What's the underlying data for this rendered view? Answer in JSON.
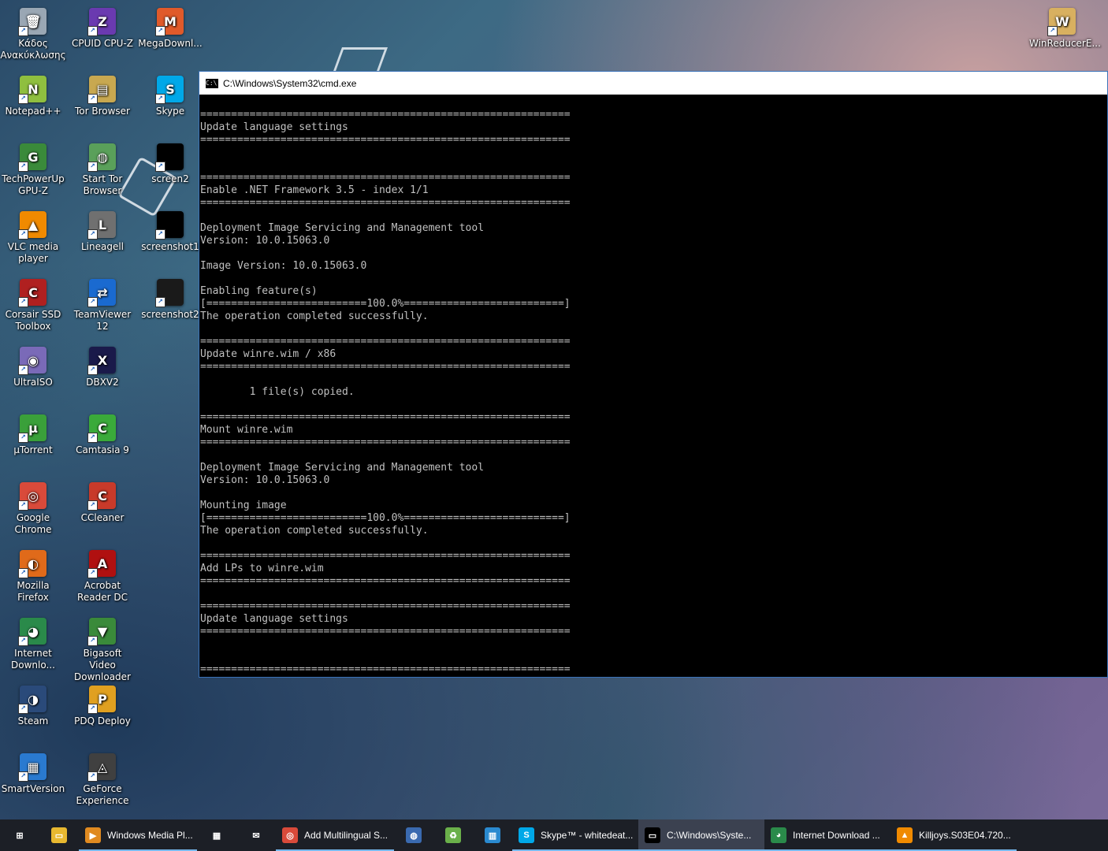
{
  "desktop": {
    "icons_col1": [
      {
        "label": "Κάδος Ανακύκλωσης",
        "icon": "recycle-bin-icon",
        "color": "#9aa7b4",
        "glyph": "🗑"
      },
      {
        "label": "Notepad++",
        "icon": "notepad-plus-plus-icon",
        "color": "#8fbf3f",
        "glyph": "N"
      },
      {
        "label": "TechPowerUp GPU-Z",
        "icon": "gpu-z-icon",
        "color": "#3a8a3a",
        "glyph": "G"
      },
      {
        "label": "VLC media player",
        "icon": "vlc-icon",
        "color": "#f08a00",
        "glyph": "▲"
      },
      {
        "label": "Corsair SSD Toolbox",
        "icon": "corsair-icon",
        "color": "#b02020",
        "glyph": "C"
      },
      {
        "label": "UltraISO",
        "icon": "ultraiso-icon",
        "color": "#7a6ab8",
        "glyph": "◉"
      },
      {
        "label": "µTorrent",
        "icon": "utorrent-icon",
        "color": "#3aa03a",
        "glyph": "µ"
      },
      {
        "label": "Google Chrome",
        "icon": "chrome-icon",
        "color": "#d94a3a",
        "glyph": "◎"
      },
      {
        "label": "Mozilla Firefox",
        "icon": "firefox-icon",
        "color": "#e06a1a",
        "glyph": "◐"
      },
      {
        "label": "Internet Downlo...",
        "icon": "idm-icon",
        "color": "#2a8a4a",
        "glyph": "◕"
      },
      {
        "label": "Steam",
        "icon": "steam-icon",
        "color": "#2a4a7a",
        "glyph": "◑"
      },
      {
        "label": "SmartVersion",
        "icon": "smartversion-icon",
        "color": "#2a7ad0",
        "glyph": "▦"
      }
    ],
    "icons_col2": [
      {
        "label": "CPUID CPU-Z",
        "icon": "cpu-z-icon",
        "color": "#6a3ab0",
        "glyph": "Z"
      },
      {
        "label": "Tor Browser",
        "icon": "tor-browser-icon",
        "color": "#c8a850",
        "glyph": "▤"
      },
      {
        "label": "Start Tor Browser",
        "icon": "start-tor-icon",
        "color": "#5aa05a",
        "glyph": "◍"
      },
      {
        "label": "Lineagell",
        "icon": "lineage-icon",
        "color": "#707070",
        "glyph": "L"
      },
      {
        "label": "TeamViewer 12",
        "icon": "teamviewer-icon",
        "color": "#1a6ad0",
        "glyph": "⇄"
      },
      {
        "label": "DBXV2",
        "icon": "dbxv2-icon",
        "color": "#1a1a4a",
        "glyph": "X"
      },
      {
        "label": "Camtasia 9",
        "icon": "camtasia-icon",
        "color": "#3aaa3a",
        "glyph": "C"
      },
      {
        "label": "CCleaner",
        "icon": "ccleaner-icon",
        "color": "#c83a2a",
        "glyph": "C"
      },
      {
        "label": "Acrobat Reader DC",
        "icon": "acrobat-icon",
        "color": "#b01010",
        "glyph": "A"
      },
      {
        "label": "Bigasoft Video Downloader ...",
        "icon": "bigasoft-icon",
        "color": "#3a8a3a",
        "glyph": "▼"
      },
      {
        "label": "PDQ Deploy",
        "icon": "pdq-deploy-icon",
        "color": "#e0a020",
        "glyph": "P"
      },
      {
        "label": "GeForce Experience",
        "icon": "geforce-icon",
        "color": "#404040",
        "glyph": "◬"
      }
    ],
    "icons_col3": [
      {
        "label": "MegaDownl...",
        "icon": "megadownloader-icon",
        "color": "#e05a2a",
        "glyph": "M"
      },
      {
        "label": "Skype",
        "icon": "skype-icon",
        "color": "#00a8e8",
        "glyph": "S"
      },
      {
        "label": "screen2",
        "icon": "screen2-icon",
        "color": "#000000",
        "glyph": ""
      },
      {
        "label": "screenshot1",
        "icon": "screenshot1-icon",
        "color": "#000000",
        "glyph": ""
      },
      {
        "label": "screenshot2",
        "icon": "screenshot2-icon",
        "color": "#1a1a1a",
        "glyph": ""
      }
    ],
    "top_right_icon": {
      "label": "WinReducerE...",
      "icon": "winreducer-icon",
      "color": "#d8b060",
      "glyph": "W"
    }
  },
  "cmd_window": {
    "title": "C:\\Windows\\System32\\cmd.exe",
    "lines": [
      "============================================================",
      "Update language settings",
      "============================================================",
      "",
      "",
      "============================================================",
      "Enable .NET Framework 3.5 - index 1/1",
      "============================================================",
      "",
      "Deployment Image Servicing and Management tool",
      "Version: 10.0.15063.0",
      "",
      "Image Version: 10.0.15063.0",
      "",
      "Enabling feature(s)",
      "[==========================100.0%==========================]",
      "The operation completed successfully.",
      "",
      "============================================================",
      "Update winre.wim / x86",
      "============================================================",
      "",
      "        1 file(s) copied.",
      "",
      "============================================================",
      "Mount winre.wim",
      "============================================================",
      "",
      "Deployment Image Servicing and Management tool",
      "Version: 10.0.15063.0",
      "",
      "Mounting image",
      "[==========================100.0%==========================]",
      "The operation completed successfully.",
      "",
      "============================================================",
      "Add LPs to winre.wim",
      "============================================================",
      "",
      "============================================================",
      "Update language settings",
      "============================================================",
      "",
      "",
      "============================================================"
    ]
  },
  "taskbar": {
    "items": [
      {
        "label": "",
        "icon": "windows-start-icon",
        "color": "#1c1f26",
        "glyph": "⊞",
        "width": 50,
        "state": "none"
      },
      {
        "label": "",
        "icon": "file-explorer-icon",
        "color": "#e8b830",
        "glyph": "▭",
        "width": 50,
        "state": "none"
      },
      {
        "label": "Windows Media Pl...",
        "icon": "windows-media-player-icon",
        "color": "#e08a20",
        "glyph": "▶",
        "width": 150,
        "state": "running"
      },
      {
        "label": "",
        "icon": "store-icon",
        "color": "#1c1f26",
        "glyph": "▦",
        "width": 50,
        "state": "none"
      },
      {
        "label": "",
        "icon": "mail-icon",
        "color": "#1c1f26",
        "glyph": "✉",
        "width": 50,
        "state": "none"
      },
      {
        "label": "Add Multilingual S...",
        "icon": "chrome-taskbar-icon",
        "color": "#d94a3a",
        "glyph": "◎",
        "width": 150,
        "state": "running"
      },
      {
        "label": "",
        "icon": "search-globe-icon",
        "color": "#3a6ab0",
        "glyph": "◍",
        "width": 50,
        "state": "none"
      },
      {
        "label": "",
        "icon": "recycle-green-icon",
        "color": "#6ab04a",
        "glyph": "♻",
        "width": 50,
        "state": "none"
      },
      {
        "label": "",
        "icon": "building-icon",
        "color": "#2a8ad0",
        "glyph": "▥",
        "width": 50,
        "state": "none"
      },
      {
        "label": "Skype™ - whitedeat...",
        "icon": "skype-taskbar-icon",
        "color": "#00a8e8",
        "glyph": "S",
        "width": 160,
        "state": "running"
      },
      {
        "label": "C:\\Windows\\Syste...",
        "icon": "cmd-taskbar-icon",
        "color": "#000000",
        "glyph": "▭",
        "width": 160,
        "state": "active"
      },
      {
        "label": "Internet Download ...",
        "icon": "idm-taskbar-icon",
        "color": "#2a8a4a",
        "glyph": "◕",
        "width": 160,
        "state": "running"
      },
      {
        "label": "Killjoys.S03E04.720...",
        "icon": "vlc-taskbar-icon",
        "color": "#f08a00",
        "glyph": "▲",
        "width": 160,
        "state": "running"
      }
    ]
  }
}
